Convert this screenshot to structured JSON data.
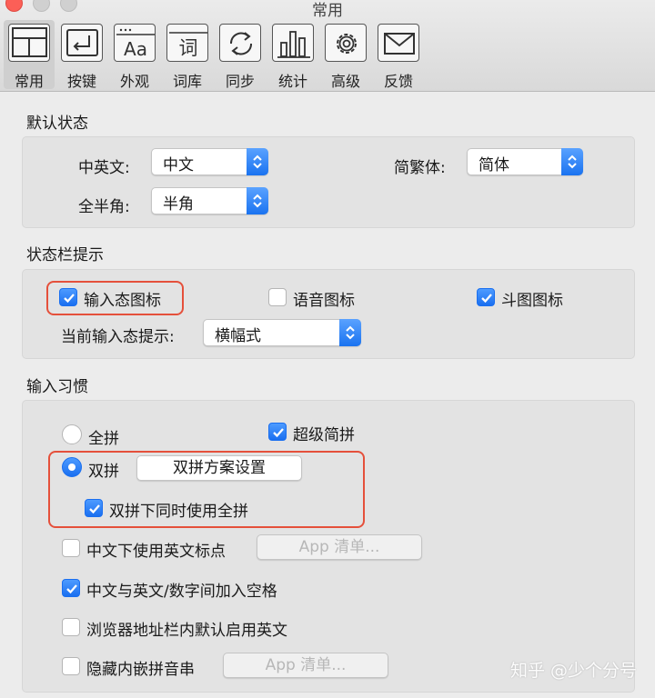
{
  "window": {
    "title": "常用"
  },
  "toolbar": {
    "items": [
      {
        "label": "常用",
        "icon": "layout-icon",
        "active": true
      },
      {
        "label": "按键",
        "icon": "keyboard-return-icon",
        "active": false
      },
      {
        "label": "外观",
        "icon": "font-aa-icon",
        "active": false
      },
      {
        "label": "词库",
        "icon": "dictionary-icon",
        "icon_text": "词",
        "active": false
      },
      {
        "label": "同步",
        "icon": "sync-icon",
        "active": false
      },
      {
        "label": "统计",
        "icon": "bar-chart-icon",
        "active": false
      },
      {
        "label": "高级",
        "icon": "gear-icon",
        "active": false
      },
      {
        "label": "反馈",
        "icon": "envelope-icon",
        "active": false
      }
    ]
  },
  "default_state": {
    "title": "默认状态",
    "zh_en_label": "中英文:",
    "zh_en_value": "中文",
    "simp_trad_label": "简繁体:",
    "simp_trad_value": "简体",
    "width_label": "全半角:",
    "width_value": "半角"
  },
  "statusbar": {
    "title": "状态栏提示",
    "input_state_icon": {
      "label": "输入态图标",
      "checked": true
    },
    "voice_icon": {
      "label": "语音图标",
      "checked": false
    },
    "meme_icon": {
      "label": "斗图图标",
      "checked": true
    },
    "hint_label": "当前输入态提示:",
    "hint_value": "横幅式"
  },
  "habits": {
    "title": "输入习惯",
    "full_pinyin": {
      "label": "全拼",
      "selected": false
    },
    "super_jianpin": {
      "label": "超级简拼",
      "checked": true
    },
    "shuangpin": {
      "label": "双拼",
      "selected": true
    },
    "shuangpin_settings_button": "双拼方案设置",
    "shuangpin_with_full": {
      "label": "双拼下同时使用全拼",
      "checked": true
    },
    "en_punct": {
      "label": "中文下使用英文标点",
      "checked": false
    },
    "en_punct_app_button": "App 清单...",
    "space_between": {
      "label": "中文与英文/数字间加入空格",
      "checked": true
    },
    "browser_en": {
      "label": "浏览器地址栏内默认启用英文",
      "checked": false
    },
    "hide_inline": {
      "label": "隐藏内嵌拼音串",
      "checked": false
    },
    "hide_inline_app_button": "App 清单..."
  },
  "watermark": "知乎 @少个分号",
  "colors": {
    "accent": "#1a73f0",
    "highlight_border": "#e5503b"
  }
}
